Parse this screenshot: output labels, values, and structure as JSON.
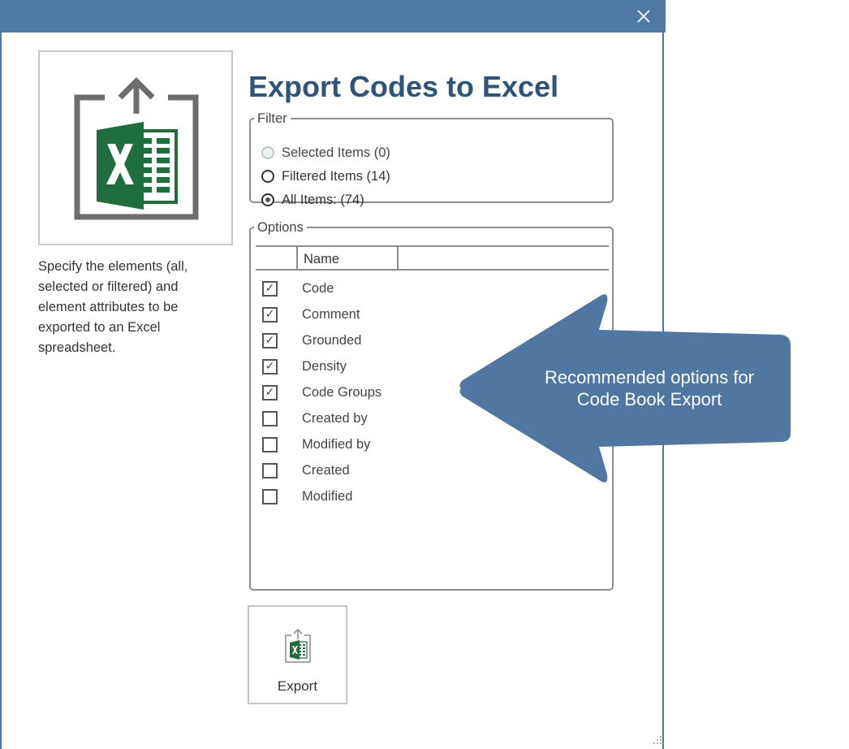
{
  "dialog": {
    "title": "Export Codes to Excel",
    "description": "Specify the elements (all, selected or filtered) and element attributes to be exported to an Excel spreadsheet."
  },
  "filter": {
    "legend": "Filter",
    "options": [
      {
        "label": "Selected Items (0)",
        "state": "disabled"
      },
      {
        "label": "Filtered Items (14)",
        "state": "unchecked"
      },
      {
        "label": "All Items: (74)",
        "state": "checked"
      }
    ]
  },
  "options": {
    "legend": "Options",
    "column_header": "Name",
    "items": [
      {
        "label": "Code",
        "checked": true
      },
      {
        "label": "Comment",
        "checked": true
      },
      {
        "label": "Grounded",
        "checked": true
      },
      {
        "label": "Density",
        "checked": true
      },
      {
        "label": "Code Groups",
        "checked": true
      },
      {
        "label": "Created by",
        "checked": false
      },
      {
        "label": "Modified by",
        "checked": false
      },
      {
        "label": "Created",
        "checked": false
      },
      {
        "label": "Modified",
        "checked": false
      }
    ]
  },
  "export_button": {
    "label": "Export",
    "icon": "excel-export-icon"
  },
  "callout": {
    "text_line1": "Recommended options for",
    "text_line2": "Code Book Export"
  },
  "colors": {
    "titlebar": "#5079a5",
    "title_text": "#2e5579",
    "excel_green": "#1e6e3e",
    "callout": "#4f77a1"
  }
}
